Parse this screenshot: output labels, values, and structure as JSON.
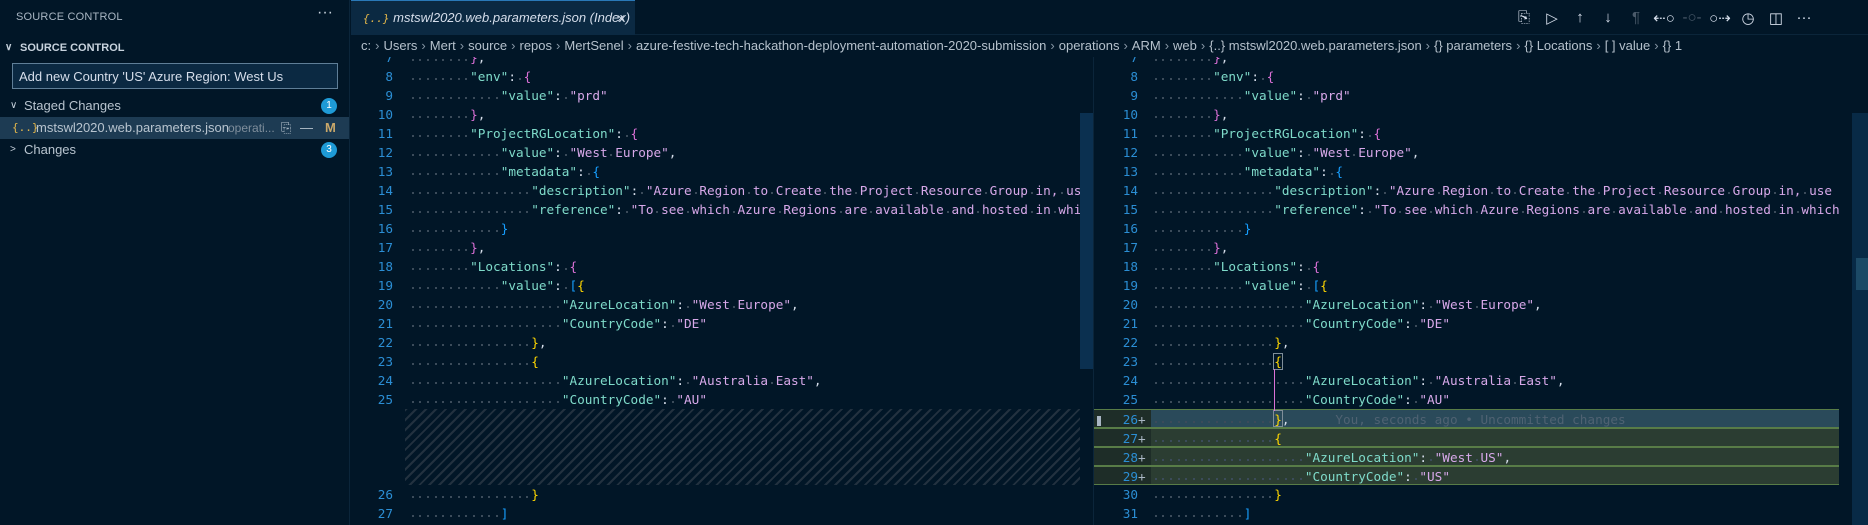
{
  "sidebar": {
    "title": "SOURCE CONTROL",
    "more": "···",
    "section": "SOURCE CONTROL",
    "commit_message": "Add new Country 'US' Azure Region: West Us",
    "staged": {
      "label": "Staged Changes",
      "count": "1"
    },
    "staged_file": {
      "icon": "{..}",
      "name": "mstswl2020.web.parameters.json",
      "path": "operati...",
      "status": "M"
    },
    "changes": {
      "label": "Changes",
      "count": "3"
    }
  },
  "tab": {
    "icon": "{..}",
    "title": "mstswl2020.web.parameters.json (Index)",
    "close": "×"
  },
  "toolbar": [
    "open-file",
    "run",
    "previous-change",
    "next-change",
    "show-whitespace",
    "revert-left",
    "inline",
    "revert-right",
    "blame",
    "split-editor",
    "more"
  ],
  "breadcrumb": [
    "c:",
    "Users",
    "Mert",
    "source",
    "repos",
    "MertSenel",
    "azure-festive-tech-hackathon-deployment-automation-2020-submission",
    "operations",
    "ARM",
    "web",
    "{..} mstswl2020.web.parameters.json",
    "{} parameters",
    "{} Locations",
    "[ ] value",
    "{} 1"
  ],
  "colors": {
    "background": "#011627",
    "key": "#7fdbca",
    "string": "#d7a8e9",
    "line_number": "#2b8ed4",
    "added_line": "#2b3d32",
    "accent": "#1e9ad6"
  },
  "blame": "You, seconds ago • Uncommitted changes",
  "lines": {
    "7": "        },",
    "8": "        \"env\": {",
    "9": "            \"value\": \"prd\"",
    "10": "        },",
    "11": "        \"ProjectRGLocation\": {",
    "12": "            \"value\": \"West Europe\",",
    "13": "            \"metadata\": {",
    "14": "                \"description\": \"Azure Region to Create the Project Resource Group in, use",
    "15": "                \"reference\": \"To see which Azure Regions are available and hosted in which",
    "16": "            }",
    "17": "        },",
    "18": "        \"Locations\": {",
    "19": "            \"value\": [{",
    "20": "                    \"AzureLocation\": \"West Europe\",",
    "21": "                    \"CountryCode\": \"DE\"",
    "22": "                },",
    "23": "                {",
    "24": "                    \"AzureLocation\": \"Australia East\",",
    "25": "                    \"CountryCode\": \"AU\"",
    "26": "                },",
    "27": "                {",
    "28": "                    \"AzureLocation\": \"West US\",",
    "29": "                    \"CountryCode\": \"US\"",
    "30": "                }",
    "31": "            ]"
  },
  "left_pane": {
    "lines": [
      7,
      8,
      9,
      10,
      11,
      12,
      13,
      14,
      15,
      16,
      17,
      18,
      19,
      20,
      21,
      22,
      23,
      24,
      25,
      "gap",
      26,
      27
    ],
    "left_text": {
      "26": "                }",
      "27": "            ]"
    }
  },
  "right_pane": {
    "lines": [
      7,
      8,
      9,
      10,
      11,
      12,
      13,
      14,
      15,
      16,
      17,
      18,
      19,
      20,
      21,
      22,
      23,
      24,
      25,
      26,
      27,
      28,
      29,
      30,
      31
    ],
    "added": [
      26,
      27,
      28,
      29
    ],
    "current": 26
  }
}
